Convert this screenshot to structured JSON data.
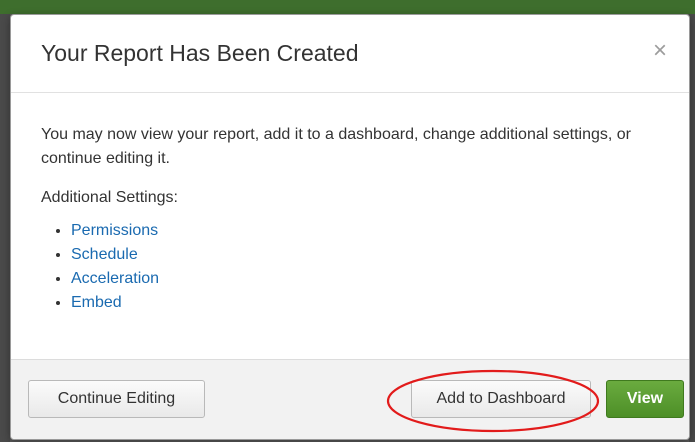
{
  "dialog": {
    "title": "Your Report Has Been Created",
    "close_icon": "×",
    "intro": "You may now view your report, add it to a dashboard, change additional settings, or continue editing it.",
    "settings_heading": "Additional Settings:",
    "settings_links": [
      {
        "label": "Permissions"
      },
      {
        "label": "Schedule"
      },
      {
        "label": "Acceleration"
      },
      {
        "label": "Embed"
      }
    ]
  },
  "footer": {
    "continue_label": "Continue Editing",
    "dashboard_label": "Add to Dashboard",
    "view_label": "View"
  },
  "colors": {
    "link": "#1a6ab0",
    "primary_button": "#5c9e35",
    "annotation": "#e21b1b",
    "header_bar": "#3e6e2d"
  },
  "icons": {
    "close": "close-icon"
  }
}
